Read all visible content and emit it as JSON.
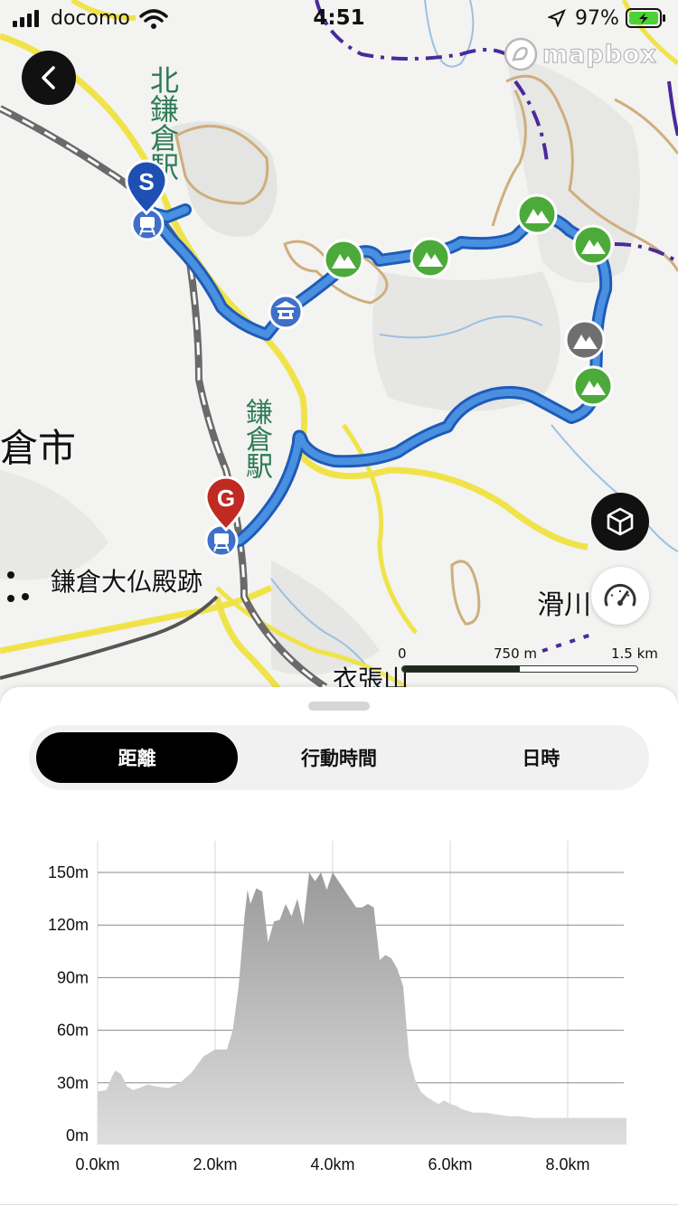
{
  "status_bar": {
    "carrier": "docomo",
    "time": "4:51",
    "battery": "97%"
  },
  "map": {
    "attribution": "mapbox",
    "labels": {
      "kitakamakura_station": "北鎌倉駅",
      "kamakura_station": "鎌倉駅",
      "city": "倉市",
      "daibutsuden": "鎌倉大仏殿跡",
      "namerikawa": "滑川",
      "kinugasa": "衣張山"
    },
    "markers": {
      "start": "S",
      "goal": "G"
    },
    "scale": {
      "zero": "0",
      "mid": "750 m",
      "max": "1.5 km"
    }
  },
  "tabs": [
    {
      "label": "距離",
      "active": true
    },
    {
      "label": "行動時間",
      "active": false
    },
    {
      "label": "日時",
      "active": false
    }
  ],
  "chart_data": {
    "type": "area",
    "title": "",
    "xlabel": "",
    "ylabel": "",
    "xlim": [
      0,
      9.0
    ],
    "ylim": [
      0,
      150
    ],
    "x_ticks": [
      "0.0km",
      "2.0km",
      "4.0km",
      "6.0km",
      "8.0km"
    ],
    "y_ticks": [
      "0m",
      "30m",
      "60m",
      "90m",
      "120m",
      "150m"
    ],
    "grid": true,
    "series": [
      {
        "x": [
          0.0,
          0.15,
          0.25,
          0.3,
          0.4,
          0.5,
          0.6,
          0.7,
          0.85,
          1.0,
          1.2,
          1.4,
          1.6,
          1.8,
          2.0,
          2.2,
          2.3,
          2.4,
          2.5,
          2.55,
          2.6,
          2.7,
          2.8,
          2.9,
          3.0,
          3.1,
          3.2,
          3.3,
          3.4,
          3.5,
          3.6,
          3.7,
          3.8,
          3.9,
          4.0,
          4.1,
          4.2,
          4.3,
          4.4,
          4.5,
          4.6,
          4.7,
          4.8,
          4.9,
          5.0,
          5.1,
          5.2,
          5.3,
          5.4,
          5.5,
          5.6,
          5.7,
          5.8,
          5.9,
          6.0,
          6.1,
          6.2,
          6.4,
          6.6,
          6.8,
          7.0,
          7.2,
          7.4,
          7.6,
          7.8,
          7.9,
          8.0,
          8.1,
          8.2,
          8.4,
          8.6,
          8.8,
          9.0
        ],
        "y": [
          25,
          26,
          34,
          37,
          35,
          28,
          26,
          27,
          29,
          28,
          27,
          30,
          36,
          45,
          49,
          49,
          60,
          85,
          125,
          140,
          132,
          141,
          139,
          110,
          122,
          123,
          132,
          125,
          135,
          120,
          150,
          145,
          150,
          140,
          150,
          145,
          140,
          135,
          130,
          130,
          132,
          130,
          100,
          103,
          101,
          95,
          85,
          45,
          32,
          25,
          22,
          20,
          18,
          20,
          18,
          17,
          15,
          13,
          13,
          12,
          11,
          11,
          10,
          10,
          10,
          10,
          10,
          10,
          10,
          10,
          10,
          10,
          10
        ]
      }
    ],
    "colors": {
      "fill_top": "#9a9a9a",
      "fill_bottom": "#dedede",
      "grid": "#8a8a8a"
    }
  }
}
